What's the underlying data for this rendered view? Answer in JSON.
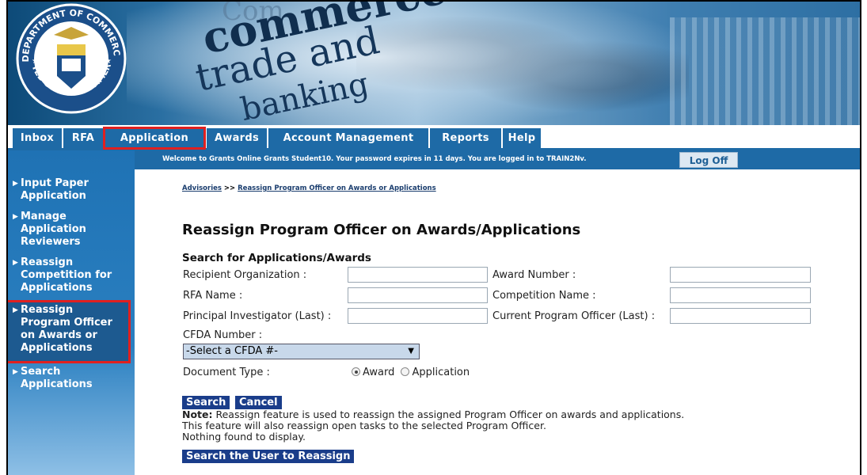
{
  "banner": {
    "words": [
      "Com",
      "commerce",
      "trade and",
      "banking"
    ],
    "seal_text_top": "DEPARTMENT OF COMMERCE",
    "seal_text_bottom": "UNITED STATES OF AMERICA"
  },
  "tabs": [
    "Inbox",
    "RFA",
    "Application",
    "Awards",
    "Account Management",
    "Reports",
    "Help"
  ],
  "active_tab": "Application",
  "welcome": {
    "text": "Welcome to Grants Online Grants Student10. Your password expires in 11 days. You are logged in to TRAIN2Nv.",
    "logoff_label": "Log Off"
  },
  "sidebar": {
    "items": [
      {
        "label": "Input Paper Application"
      },
      {
        "label": "Manage Application Reviewers"
      },
      {
        "label": "Reassign Competition for Applications"
      },
      {
        "label": "Reassign Program Officer on Awards or Applications",
        "selected": true
      },
      {
        "label": "Search Applications"
      }
    ]
  },
  "breadcrumb": {
    "root": "Advisories",
    "separator": ">>",
    "current": "Reassign Program Officer on Awards or Applications"
  },
  "page_title": "Reassign Program Officer on Awards/Applications",
  "search": {
    "section_title": "Search for Applications/Awards",
    "fields": {
      "recipient_org": {
        "label": "Recipient Organization :",
        "value": ""
      },
      "award_number": {
        "label": "Award Number :",
        "value": ""
      },
      "rfa_name": {
        "label": "RFA Name :",
        "value": ""
      },
      "competition_name": {
        "label": "Competition Name :",
        "value": ""
      },
      "pi_last": {
        "label": "Principal Investigator (Last) :",
        "value": ""
      },
      "current_po_last": {
        "label": "Current Program Officer (Last) :",
        "value": ""
      }
    },
    "cfda_label": "CFDA Number :",
    "cfda_selected": "-Select a CFDA #-",
    "doc_type_label": "Document Type :",
    "doc_type_options": [
      "Award",
      "Application"
    ],
    "doc_type_selected": "Award"
  },
  "buttons": {
    "search": "Search",
    "cancel": "Cancel",
    "search_user": "Search the User to Reassign"
  },
  "note": {
    "prefix": "Note:",
    "line1": " Reassign feature is used to reassign the assigned Program Officer on awards and applications.",
    "line2": "This feature will also reassign open tasks to the selected Program Officer.",
    "empty": "Nothing found to display."
  }
}
